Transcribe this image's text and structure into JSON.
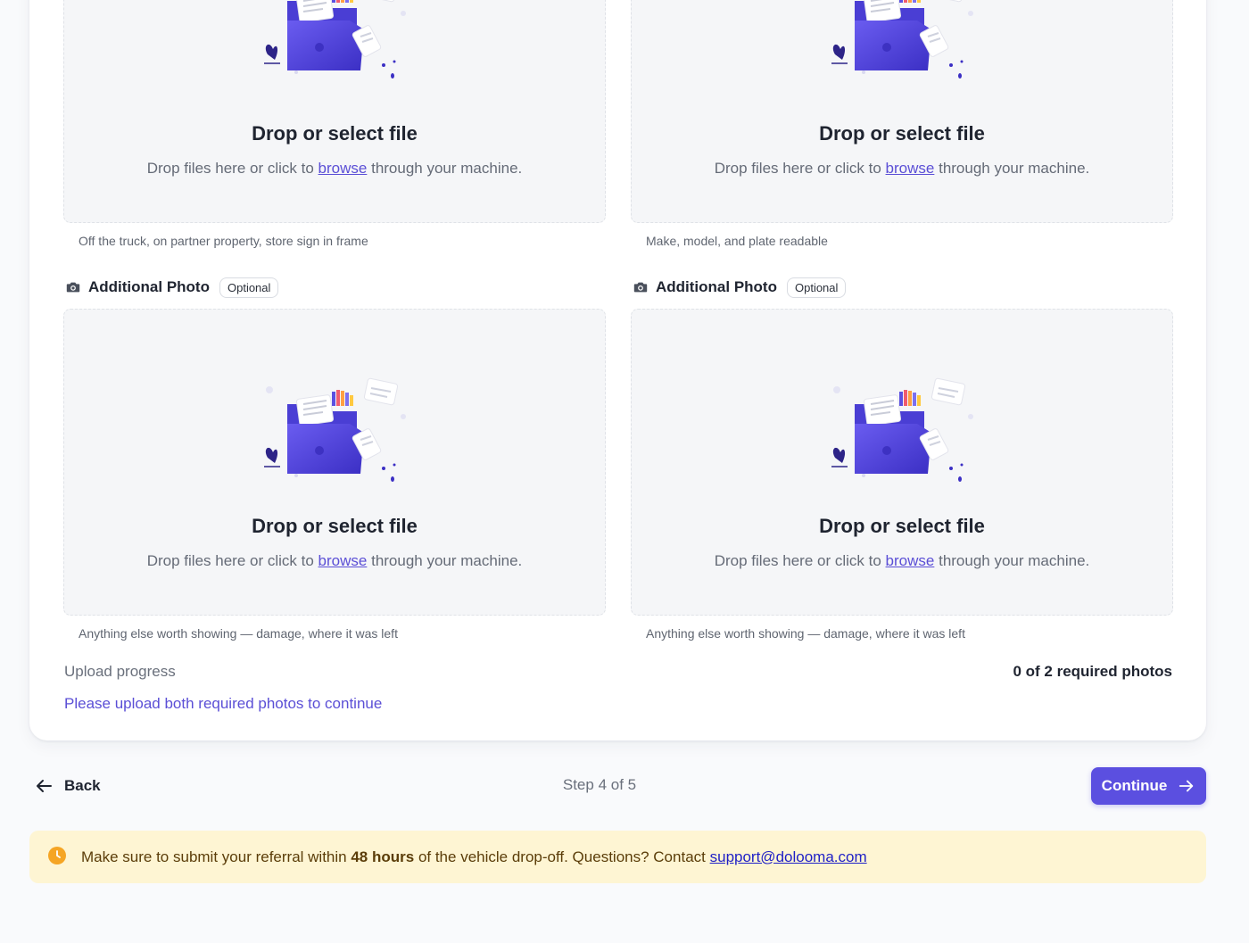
{
  "dropzone": {
    "title": "Drop or select file",
    "sub_before": "Drop files here or click to",
    "browse": "browse",
    "sub_after": "through your machine."
  },
  "photos": [
    {
      "hint": "Off the truck, on partner property, store sign in frame"
    },
    {
      "hint": "Make, model, and plate readable"
    },
    {
      "label": "Additional Photo",
      "badge": "Optional",
      "hint": "Anything else worth showing — damage, where it was left"
    },
    {
      "label": "Additional Photo",
      "badge": "Optional",
      "hint": "Anything else worth showing — damage, where it was left"
    }
  ],
  "progress": {
    "label": "Upload progress",
    "count": "0 of 2 required photos",
    "message": "Please upload both required photos to continue"
  },
  "nav": {
    "back": "Back",
    "step": "Step 4 of 5",
    "continue": "Continue"
  },
  "notice": {
    "before": "Make sure to submit your referral within",
    "bold": "48 hours",
    "after": "of the vehicle drop-off. Questions? Contact",
    "email": "support@dolooma.com"
  },
  "icons": {
    "photo_label": "camera-icon",
    "back": "arrow-left-icon",
    "continue": "arrow-right-icon",
    "notice": "clock-icon",
    "dropzone": "folder-illustration"
  },
  "colors": {
    "accent": "#5b4fe0",
    "notice_bg": "#fef5d3",
    "notice_icon": "#f5a524"
  }
}
